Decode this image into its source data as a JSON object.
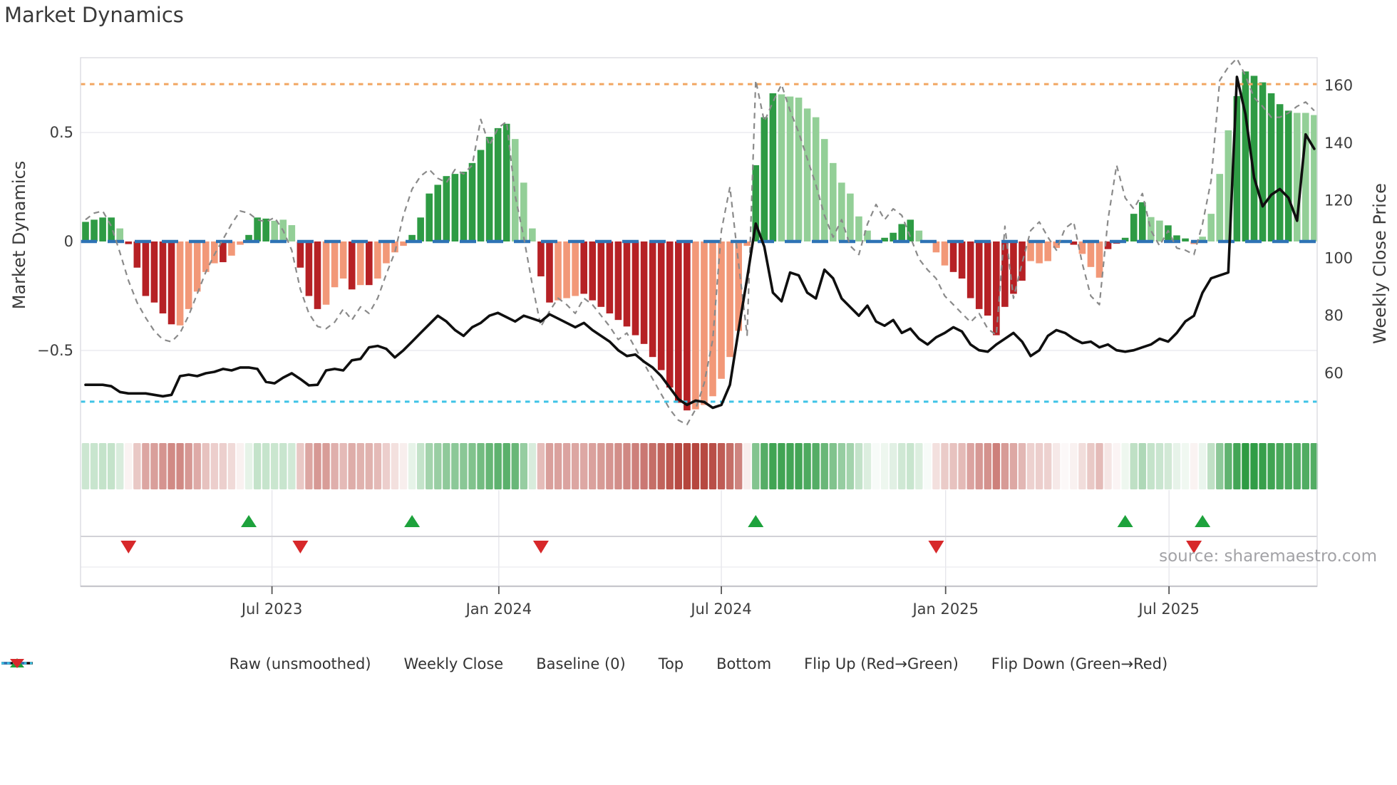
{
  "title": "Market Dynamics",
  "source": "source: sharemaestro.com",
  "axes": {
    "left_label": "Market Dynamics",
    "right_label": "Weekly Close Price",
    "left_ticks": [
      {
        "label": "0.5",
        "value": 0.5
      },
      {
        "label": "0",
        "value": 0
      },
      {
        "label": "−0.5",
        "value": -0.5
      }
    ],
    "right_ticks": [
      {
        "label": "160",
        "value": 160
      },
      {
        "label": "140",
        "value": 140
      },
      {
        "label": "120",
        "value": 120
      },
      {
        "label": "100",
        "value": 100
      },
      {
        "label": "80",
        "value": 80
      },
      {
        "label": "60",
        "value": 60
      }
    ],
    "x_ticks": [
      {
        "label": "Jul 2023",
        "week": 21.7
      },
      {
        "label": "Jan 2024",
        "week": 48.1
      },
      {
        "label": "Jul 2024",
        "week": 74.0
      },
      {
        "label": "Jan 2025",
        "week": 100.1
      },
      {
        "label": "Jul 2025",
        "week": 126.1
      }
    ]
  },
  "legend": {
    "items": [
      {
        "label": "Raw (unsmoothed)",
        "style": "dashed-line",
        "color": "#8a8a8a"
      },
      {
        "label": "Weekly Close",
        "style": "solid-line",
        "color": "#111111"
      },
      {
        "label": "Baseline (0)",
        "style": "long-dash-line",
        "color": "#2e73b5"
      },
      {
        "label": "Top",
        "style": "dotted-line",
        "color": "#f2a661"
      },
      {
        "label": "Bottom",
        "style": "dotted-line",
        "color": "#3ec3e6"
      },
      {
        "label": "Flip Up (Red→Green)",
        "style": "triangle-up",
        "color": "#1da23c"
      },
      {
        "label": "Flip Down (Green→Red)",
        "style": "triangle-down",
        "color": "#d7282a"
      }
    ]
  },
  "colors": {
    "bar_green_dark": "#2e9b44",
    "bar_green_light": "#93cf97",
    "bar_red_dark": "#b62125",
    "bar_red_light": "#f29878",
    "baseline": "#2e73b5",
    "top_line": "#f2a661",
    "bottom_line": "#3ec3e6",
    "raw_line": "#8a8a8a",
    "price_line": "#0f0f0f",
    "flip_up": "#1da23c",
    "flip_down": "#d7282a",
    "heat_green": "#2e9b43",
    "heat_red": "#b5443c"
  },
  "chart_data": {
    "type": "bar",
    "subtype": "combo-oscillator-with-price",
    "x_start_date": "2023-01-30",
    "x_freq": "weekly",
    "n_points": 144,
    "ylim_left": [
      -0.88,
      0.845
    ],
    "ylim_right_visible": [
      60,
      160
    ],
    "baseline": 0,
    "top_threshold": 0.722,
    "bottom_threshold": -0.735,
    "grid": "horizontal at ±0.5, vertical at半year ticks in marker band",
    "legend_position": "bottom center",
    "series": [
      {
        "name": "Market Dynamics (smoothed bars)",
        "type": "bar",
        "axis": "left",
        "values": [
          0.09,
          0.1,
          0.11,
          0.11,
          0.06,
          -0.012,
          -0.12,
          -0.25,
          -0.28,
          -0.33,
          -0.38,
          -0.385,
          -0.31,
          -0.23,
          -0.14,
          -0.1,
          -0.095,
          -0.065,
          -0.015,
          0.03,
          0.11,
          0.105,
          0.095,
          0.1,
          0.075,
          -0.12,
          -0.25,
          -0.31,
          -0.29,
          -0.21,
          -0.17,
          -0.22,
          -0.2,
          -0.2,
          -0.17,
          -0.1,
          -0.05,
          -0.02,
          0.03,
          0.11,
          0.22,
          0.26,
          0.3,
          0.31,
          0.32,
          0.36,
          0.42,
          0.48,
          0.52,
          0.54,
          0.47,
          0.27,
          0.06,
          -0.16,
          -0.28,
          -0.27,
          -0.26,
          -0.25,
          -0.24,
          -0.27,
          -0.3,
          -0.33,
          -0.36,
          -0.39,
          -0.43,
          -0.47,
          -0.53,
          -0.59,
          -0.67,
          -0.74,
          -0.775,
          -0.77,
          -0.75,
          -0.71,
          -0.63,
          -0.53,
          -0.41,
          -0.02,
          0.35,
          0.57,
          0.68,
          0.675,
          0.665,
          0.66,
          0.61,
          0.57,
          0.47,
          0.36,
          0.27,
          0.22,
          0.115,
          0.05,
          0.005,
          0.017,
          0.04,
          0.08,
          0.1,
          0.05,
          0.005,
          -0.05,
          -0.11,
          -0.14,
          -0.17,
          -0.26,
          -0.31,
          -0.34,
          -0.43,
          -0.3,
          -0.24,
          -0.18,
          -0.09,
          -0.1,
          -0.09,
          -0.03,
          -0.005,
          -0.015,
          -0.057,
          -0.117,
          -0.166,
          -0.035,
          -0.01,
          0.017,
          0.127,
          0.18,
          0.112,
          0.096,
          0.074,
          0.028,
          0.014,
          -0.012,
          0.022,
          0.127,
          0.31,
          0.51,
          0.667,
          0.78,
          0.76,
          0.73,
          0.68,
          0.63,
          0.6,
          0.59,
          0.59,
          0.58
        ],
        "shade_flags": "ddddlddddddllllldlldddllldddllldldllllddddddddddddlllddllldddddddddddddllllllldddllllllllllllddddlllldddddddddllllldllldddddlldddllllldddddddllllllll"
      },
      {
        "name": "Raw (unsmoothed)",
        "type": "line",
        "axis": "left",
        "values": [
          0.1,
          0.13,
          0.14,
          0.07,
          -0.05,
          -0.18,
          -0.28,
          -0.35,
          -0.41,
          -0.45,
          -0.46,
          -0.42,
          -0.34,
          -0.24,
          -0.14,
          -0.06,
          0.01,
          0.08,
          0.14,
          0.13,
          0.1,
          0.09,
          0.11,
          0.05,
          -0.04,
          -0.22,
          -0.33,
          -0.39,
          -0.4,
          -0.37,
          -0.31,
          -0.36,
          -0.3,
          -0.33,
          -0.26,
          -0.15,
          -0.05,
          0.12,
          0.24,
          0.3,
          0.33,
          0.29,
          0.27,
          0.33,
          0.31,
          0.35,
          0.56,
          0.44,
          0.52,
          0.55,
          0.21,
          0.02,
          -0.2,
          -0.39,
          -0.32,
          -0.26,
          -0.29,
          -0.33,
          -0.26,
          -0.29,
          -0.34,
          -0.39,
          -0.45,
          -0.42,
          -0.49,
          -0.56,
          -0.63,
          -0.7,
          -0.77,
          -0.82,
          -0.84,
          -0.77,
          -0.65,
          -0.45,
          0.05,
          0.25,
          -0.1,
          -0.43,
          0.74,
          0.55,
          0.64,
          0.72,
          0.6,
          0.5,
          0.38,
          0.26,
          0.12,
          0.02,
          0.1,
          -0.02,
          -0.06,
          0.08,
          0.17,
          0.1,
          0.15,
          0.12,
          0.02,
          -0.08,
          -0.13,
          -0.17,
          -0.25,
          -0.29,
          -0.33,
          -0.37,
          -0.33,
          -0.4,
          -0.43,
          0.07,
          -0.26,
          -0.1,
          0.05,
          0.09,
          0.02,
          -0.04,
          0.06,
          0.09,
          -0.1,
          -0.25,
          -0.29,
          0.1,
          0.35,
          0.2,
          0.15,
          0.22,
          0.05,
          -0.02,
          0.05,
          -0.03,
          -0.04,
          -0.06,
          0.08,
          0.28,
          0.74,
          0.8,
          0.84,
          0.76,
          0.66,
          0.62,
          0.57,
          0.57,
          0.59,
          0.62,
          0.64,
          0.6
        ]
      },
      {
        "name": "Weekly Close",
        "type": "line",
        "axis": "right",
        "values": [
          56,
          56,
          56,
          55.5,
          53.5,
          53,
          53,
          53,
          52.5,
          52,
          52.5,
          59,
          59.5,
          59,
          60,
          60.5,
          61.5,
          61,
          62,
          62,
          61.5,
          57,
          56.5,
          58.5,
          60,
          58,
          55.8,
          56,
          61,
          61.5,
          61,
          64.5,
          65,
          69,
          69.5,
          68.5,
          65.5,
          68,
          71,
          74,
          77,
          80,
          78,
          75,
          73,
          76,
          77.5,
          80,
          81,
          79.5,
          78,
          80,
          79,
          78,
          80.5,
          79,
          77.5,
          76,
          77.5,
          75,
          73,
          71,
          68,
          66,
          66.5,
          64,
          62,
          59,
          55,
          51,
          49,
          50.5,
          50,
          48,
          49,
          56,
          75,
          93,
          112,
          104,
          88,
          85,
          95,
          94,
          88,
          86,
          96,
          93,
          86,
          83,
          80,
          83.5,
          78,
          76.5,
          78.5,
          74,
          75.5,
          72,
          70,
          72.5,
          74,
          76,
          74.5,
          70,
          68,
          67.5,
          70,
          72,
          74,
          71,
          66,
          68,
          73,
          75,
          74,
          72,
          70.5,
          71,
          69,
          70,
          68,
          67.5,
          68,
          69,
          70,
          72,
          71,
          74,
          78,
          80,
          88,
          93,
          94,
          95,
          163,
          150,
          128,
          118,
          122,
          124,
          121,
          113,
          143,
          138
        ]
      }
    ],
    "heatmap_strip": "mirrors bar values as red/green intensity cells",
    "flip_up_weeks": [
      19,
      38,
      78,
      121,
      130
    ],
    "flip_down_weeks": [
      5,
      25,
      53,
      99,
      129
    ]
  }
}
